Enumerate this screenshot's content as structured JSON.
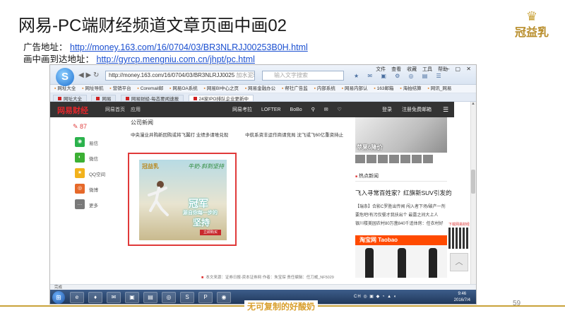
{
  "slide": {
    "title": "网易-PC端财经频道文章页画中画02",
    "ad_label": "广告地址：",
    "ad_url": "http://money.163.com/16/0704/03/BR3NLRJJ00253B0H.html",
    "landing_label": "画中画到达地址：",
    "landing_url": "http://gyrcp.mengniu.com.cn/jhpt/pc.html",
    "logo_text": "冠益乳",
    "page_number": "59",
    "footer_slogan": "无可复制的好酸奶"
  },
  "browser": {
    "logo_letter": "S",
    "address": "http://money.163.com/16/0704/03/BR3NLRJJ0025",
    "address_hint": "加水泥球",
    "search_placeholder": "输入文字搜索",
    "menu": [
      "文件",
      "查看",
      "收藏",
      "工具",
      "帮助"
    ],
    "bookmarks": [
      "网址大全",
      "网址导航",
      "营销平台",
      "Coremail邮",
      "网易OA系统",
      "网易BI中心之页",
      "网易金融办公",
      "帮社广告监",
      "内部系统",
      "网易内部认",
      "163邮箱",
      "海拍结算",
      "网讯_网易"
    ],
    "tabs": [
      "网址大全",
      "网易",
      "网易财经-每态要闻速报",
      "24家IPO排队企业更新中"
    ],
    "status": "完成"
  },
  "site": {
    "logo": "网易财经",
    "nav": [
      "网易首页",
      "应用"
    ],
    "right_nav": [
      "网易考拉",
      "LOFTER",
      "BoBo"
    ],
    "login": [
      "登录",
      "注册免费邮箱"
    ]
  },
  "share": {
    "comment_count": "87",
    "items": [
      {
        "label": "易信",
        "color": "#2bb24c"
      },
      {
        "label": "微信",
        "color": "#3cb034"
      },
      {
        "label": "QQ空间",
        "color": "#f2b21c"
      },
      {
        "label": "微博",
        "color": "#e6692a"
      },
      {
        "label": "更多",
        "color": "#7a7a7a"
      }
    ]
  },
  "article": {
    "section": "公司新闻",
    "related": [
      "中央漫业井购新回购或将飞翼打  业绩多请堆兑现",
      "中航系资丰运作商请竞局  沈飞或飞60亿重资持止"
    ],
    "source": "本文来源：证券日报-资本证券网  作者：朱宝琛  责任编辑：任刀威_NF5029"
  },
  "ad": {
    "brand": "冠益乳",
    "slogan": "牛奶·斜到坚持",
    "headline_1": "冠军",
    "headline_2": "源自你每一步的",
    "headline_3": "坚持",
    "cta": "立即购买"
  },
  "right": {
    "product_caption": "苹果6降价",
    "hot_title": "热点新闻",
    "hot_headline": "飞入寻常百姓家？红旗新SUV引发的",
    "hot_news": [
      "【瑞条】合影C罗胜出传闻  闯入者下场/破产一剂",
      "要危吧!有污仅餐才我扶出个  最露之间大上人",
      "银川楼美园农村80万盏840千追体房：任衣村好"
    ],
    "taobao_banner": "淘宝网 Taobao",
    "qr_label": "下载网易财经"
  },
  "taskbar": {
    "start": "⊞",
    "apps": [
      "e",
      "♦",
      "✉",
      "▣",
      "▤",
      "◎",
      "S",
      "P",
      "◉"
    ],
    "tray": "CH ◎ ▣ ◆ ◔ ▲ ◐",
    "time": "9:46",
    "date": "2016/7/4"
  }
}
